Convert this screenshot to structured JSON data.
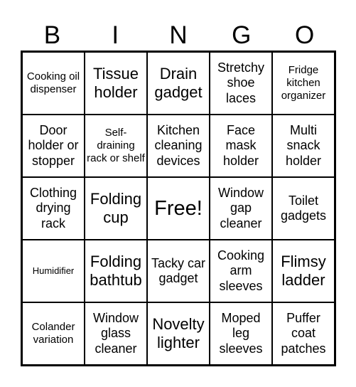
{
  "header": {
    "letters": [
      "B",
      "I",
      "N",
      "G",
      "O"
    ]
  },
  "cells": [
    [
      {
        "text": "Cooking oil dispenser",
        "size": "s-s"
      },
      {
        "text": "Tissue holder",
        "size": "s-l"
      },
      {
        "text": "Drain gadget",
        "size": "s-l"
      },
      {
        "text": "Stretchy shoe laces",
        "size": "s-m"
      },
      {
        "text": "Fridge kitchen organizer",
        "size": "s-s"
      }
    ],
    [
      {
        "text": "Door holder or stopper",
        "size": "s-m"
      },
      {
        "text": "Self-draining rack or shelf",
        "size": "s-s"
      },
      {
        "text": "Kitchen cleaning devices",
        "size": "s-m"
      },
      {
        "text": "Face mask holder",
        "size": "s-m"
      },
      {
        "text": "Multi snack holder",
        "size": "s-m"
      }
    ],
    [
      {
        "text": "Clothing drying rack",
        "size": "s-m"
      },
      {
        "text": "Folding cup",
        "size": "s-l"
      },
      {
        "text": "Free!",
        "size": "s-xl"
      },
      {
        "text": "Window gap cleaner",
        "size": "s-m"
      },
      {
        "text": "Toilet gadgets",
        "size": "s-m"
      }
    ],
    [
      {
        "text": "Humidifier",
        "size": "s-xs"
      },
      {
        "text": "Folding bathtub",
        "size": "s-l"
      },
      {
        "text": "Tacky car gadget",
        "size": "s-m"
      },
      {
        "text": "Cooking arm sleeves",
        "size": "s-m"
      },
      {
        "text": "Flimsy ladder",
        "size": "s-l"
      }
    ],
    [
      {
        "text": "Colander variation",
        "size": "s-s"
      },
      {
        "text": "Window glass cleaner",
        "size": "s-m"
      },
      {
        "text": "Novelty lighter",
        "size": "s-l"
      },
      {
        "text": "Moped leg sleeves",
        "size": "s-m"
      },
      {
        "text": "Puffer coat patches",
        "size": "s-m"
      }
    ]
  ]
}
